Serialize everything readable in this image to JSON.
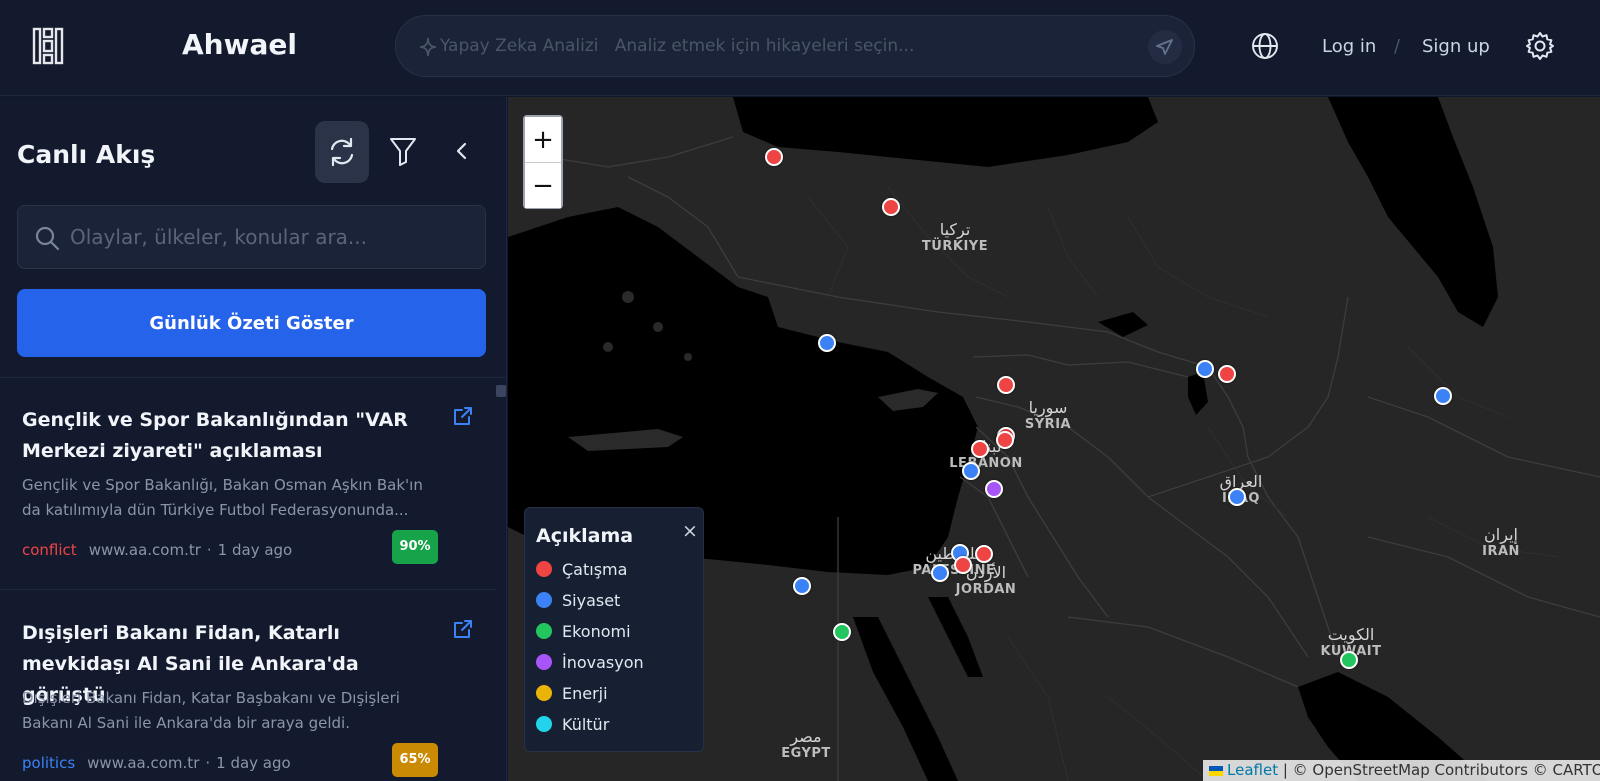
{
  "header": {
    "brand": "Ahwael",
    "ai_label": "Yapay Zeka Analizi",
    "ai_hint": "Analiz etmek için hikayeleri seçin...",
    "login": "Log in",
    "separator": "/",
    "signup": "Sign up"
  },
  "sidebar": {
    "title": "Canlı Akış",
    "search_placeholder": "Olaylar, ülkeler, konular ara...",
    "summary_button": "Günlük Özeti Göster",
    "cards": [
      {
        "title": "Gençlik ve Spor Bakanlığından \"VAR Merkezi ziyareti\" açıklaması",
        "description": "Gençlik ve Spor Bakanlığı, Bakan Osman Aşkın Bak'ın da katılımıyla dün Türkiye Futbol Federasyonunda...",
        "category": "conflict",
        "source": "www.aa.com.tr",
        "time": "1 day ago",
        "score": "90%",
        "score_color": "#16a34a",
        "category_color": "#ef4444"
      },
      {
        "title": "Dışişleri Bakanı Fidan, Katarlı mevkidaşı Al Sani ile Ankara'da görüştü",
        "description": "Dışişleri Bakanı Fidan, Katar Başbakanı ve Dışişleri Bakanı Al Sani ile Ankara'da bir araya geldi.",
        "category": "politics",
        "source": "www.aa.com.tr",
        "time": "1 day ago",
        "score": "65%",
        "score_color": "#ca8a04",
        "category_color": "#3b82f6"
      }
    ]
  },
  "map": {
    "zoom_in": "+",
    "zoom_out": "−",
    "labels": [
      {
        "ar": "تركيا",
        "en": "TÜRKIYE"
      },
      {
        "ar": "سوريا",
        "en": "SYRIA"
      },
      {
        "ar": "لبنان",
        "en": "LEBANON"
      },
      {
        "ar": "العراق",
        "en": "IRAQ"
      },
      {
        "ar": "إيران",
        "en": "IRAN"
      },
      {
        "ar": "فلسطين",
        "en": "PALESTINE"
      },
      {
        "ar": "الأردن",
        "en": "JORDAN"
      },
      {
        "ar": "الكويت",
        "en": "KUWAIT"
      },
      {
        "ar": "مصر",
        "en": "EGYPT"
      }
    ],
    "legend": {
      "title": "Açıklama",
      "close": "×",
      "items": [
        {
          "label": "Çatışma",
          "color": "#ef4444"
        },
        {
          "label": "Siyaset",
          "color": "#3b82f6"
        },
        {
          "label": "Ekonomi",
          "color": "#22c55e"
        },
        {
          "label": "İnovasyon",
          "color": "#a855f7"
        },
        {
          "label": "Enerji",
          "color": "#eab308"
        },
        {
          "label": "Kültür",
          "color": "#22d3ee"
        }
      ]
    },
    "markers": [
      {
        "category": "conflict"
      },
      {
        "category": "conflict"
      },
      {
        "category": "politics"
      },
      {
        "category": "conflict"
      },
      {
        "category": "conflict"
      },
      {
        "category": "conflict"
      },
      {
        "category": "conflict"
      },
      {
        "category": "politics"
      },
      {
        "category": "innovation"
      },
      {
        "category": "politics"
      },
      {
        "category": "politics"
      },
      {
        "category": "conflict"
      },
      {
        "category": "conflict"
      },
      {
        "category": "politics"
      },
      {
        "category": "politics"
      },
      {
        "category": "economy"
      },
      {
        "category": "politics"
      },
      {
        "category": "economy"
      },
      {
        "category": "politics"
      },
      {
        "category": "conflict"
      }
    ],
    "attribution": {
      "leaflet": "Leaflet",
      "rest": " | © OpenStreetMap Contributors © CARTO"
    }
  },
  "colors": {
    "conflict": "#ef4444",
    "politics": "#3b82f6",
    "economy": "#22c55e",
    "innovation": "#a855f7",
    "energy": "#eab308",
    "culture": "#22d3ee",
    "accent": "#2563eb"
  },
  "icons": {
    "logo": "logo-icon",
    "ai": "sparkle-icon",
    "send": "send-icon",
    "language": "globe-icon",
    "settings": "gear-icon",
    "refresh": "refresh-icon",
    "filter": "filter-icon",
    "collapse": "chevron-left-icon",
    "search": "search-icon",
    "external": "external-link-icon"
  }
}
